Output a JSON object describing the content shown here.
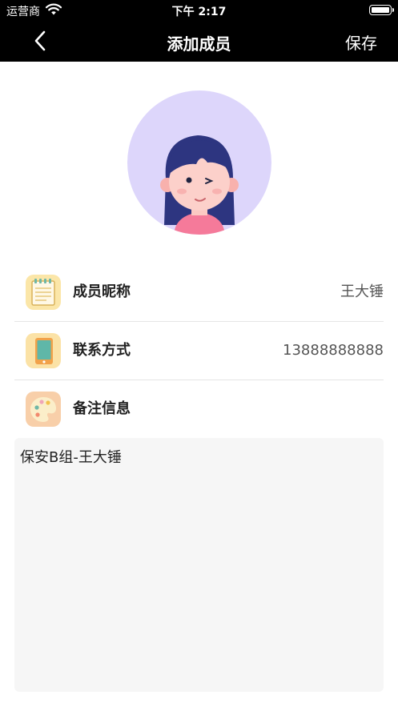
{
  "status_bar": {
    "carrier": "运营商",
    "time": "下午 2:17"
  },
  "nav": {
    "title": "添加成员",
    "save_label": "保存"
  },
  "fields": {
    "nickname": {
      "label": "成员昵称",
      "value": "王大锤"
    },
    "contact": {
      "label": "联系方式",
      "value": "13888888888"
    },
    "remark": {
      "label": "备注信息",
      "value": "保安B组-王大锤"
    }
  },
  "icons": {
    "back": "chevron-left-icon",
    "nickname": "notepad-icon",
    "contact": "phone-icon",
    "remark": "palette-icon"
  },
  "colors": {
    "nav_bg": "#000000",
    "avatar_bg": "#ddd6fb",
    "remark_bg": "#f6f6f6"
  }
}
